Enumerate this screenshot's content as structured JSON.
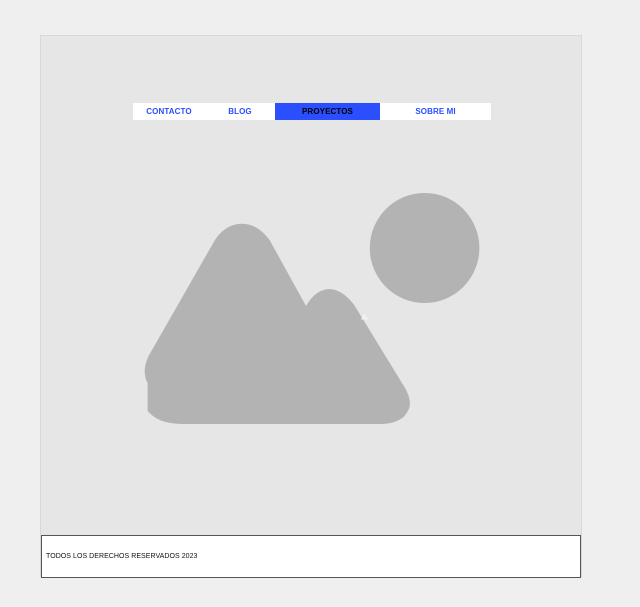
{
  "nav": {
    "items": [
      {
        "label": "CONTACTO",
        "active": false
      },
      {
        "label": "BLOG",
        "active": false
      },
      {
        "label": "PROYECTOS",
        "active": true
      },
      {
        "label": "SOBRE MI",
        "active": false
      }
    ]
  },
  "hero": {
    "image_icon": "image-placeholder-icon"
  },
  "footer": {
    "text": "TODOS LOS DERECHOS RESERVADOS 2023"
  },
  "colors": {
    "accent": "#2b4eff",
    "page_background": "#efefef",
    "hero_background": "#e6e6e6",
    "placeholder_shape": "#b3b3b3",
    "footer_border": "#555555"
  }
}
